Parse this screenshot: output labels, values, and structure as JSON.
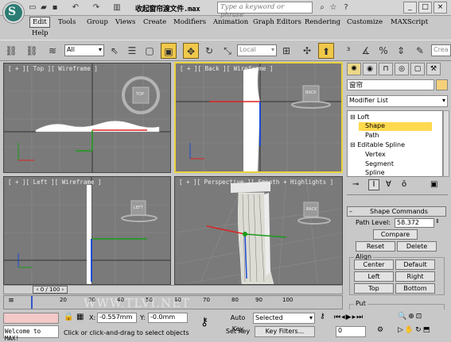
{
  "app": {
    "logo_text": "S",
    "title": "收起窗帘渡文件.max",
    "search_placeholder": "Type a keyword or phrase",
    "win_controls": [
      "_",
      "□",
      "×"
    ]
  },
  "menu": [
    "Edit",
    "Tools",
    "Group",
    "Views",
    "Create",
    "Modifiers",
    "Animation",
    "Graph Editors",
    "Rendering",
    "Customize",
    "MAXScript",
    "Help"
  ],
  "toolbar": {
    "filter": "All",
    "coord": "Local",
    "named_sel": "Crea"
  },
  "viewports": {
    "top": "[ + ][ Top ][ Wireframe ]",
    "back": "[ + ][ Back ][ Wireframe ]",
    "left": "[ + ][ Left ][ Wireframe ]",
    "persp": "[ + ][ Perspective ][ Smooth + Highlights ]",
    "cube": {
      "top": "TOP",
      "back": "BACK",
      "left": "LEFT",
      "persp": "BACK"
    }
  },
  "panel": {
    "object_name": "窗帘",
    "modifier_list": "Modifier List",
    "stack": [
      "Loft",
      "Shape",
      "Path",
      "Editable Spline",
      "Vertex",
      "Segment",
      "Spline"
    ],
    "rollout_title": "Shape Commands",
    "path_level_label": "Path Level:",
    "path_level_value": "58.372",
    "compare": "Compare",
    "reset": "Reset",
    "delete": "Delete",
    "align_label": "Align",
    "center": "Center",
    "default": "Default",
    "left": "Left",
    "right": "Right",
    "top": "Top",
    "bottom": "Bottom",
    "put_label": "Put"
  },
  "timeline": {
    "frame": "0 / 100",
    "ticks": [
      "10",
      "20",
      "30",
      "40",
      "50",
      "60",
      "70",
      "80",
      "90",
      "100"
    ],
    "ticks_bottom": [
      "0",
      "10",
      "20",
      "30",
      "40",
      "50",
      "60",
      "70",
      "80",
      "90",
      "100"
    ]
  },
  "status": {
    "listener": "Welcome to MAX!",
    "x_label": "X:",
    "x_value": "-0.557mm",
    "y_label": "Y:",
    "y_value": "-0.0mm",
    "prompt": "Click or click-and-drag to select objects",
    "autokey": "Auto Key",
    "selected": "Selected",
    "setkey": "Set Key",
    "keyfilters": "Key Filters...",
    "frame_field": "0"
  },
  "watermark": "WWW.TLVI.NET"
}
